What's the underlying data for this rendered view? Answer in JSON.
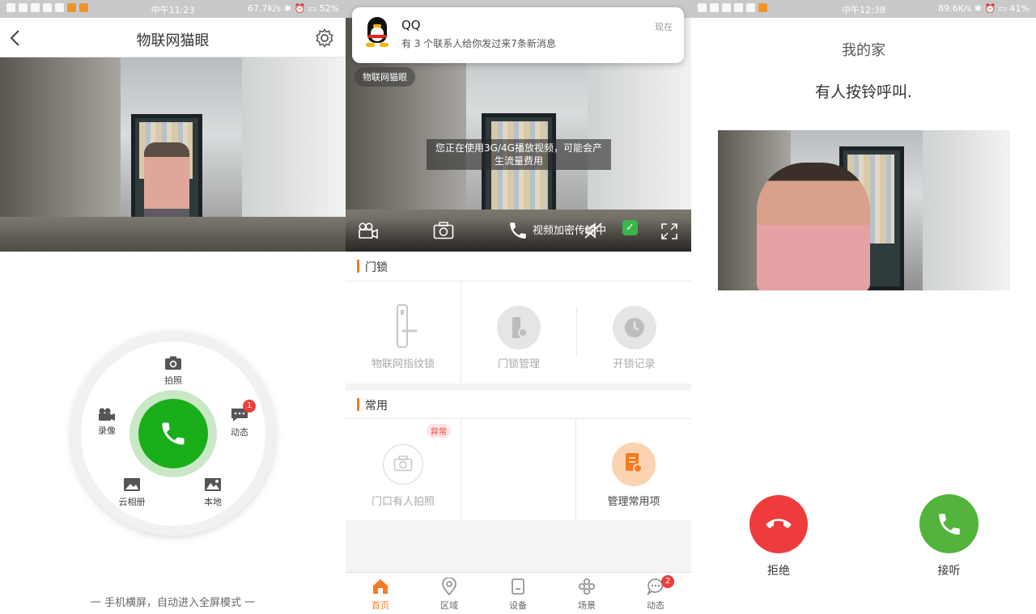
{
  "status": {
    "p1": {
      "time": "中午11:23",
      "speed": "67.7K/s",
      "battery": "52%"
    },
    "p3": {
      "time": "中午12:38",
      "speed": "89.6K/s",
      "battery": "41%"
    }
  },
  "screen1": {
    "title": "物联网猫眼",
    "wheel": {
      "photo": "拍照",
      "record": "录像",
      "moments": "动态",
      "moments_badge": "1",
      "cloud_album": "云相册",
      "local": "本地"
    },
    "hint": "一 手机横屏，自动进入全屏模式 一"
  },
  "screen2": {
    "notification": {
      "app": "QQ",
      "time": "现在",
      "message": "有 3 个联系人给你发过来7条新消息"
    },
    "cam_label": "物联网猫眼",
    "toast": "您正在使用3G/4G播放视频，可能会产生流量费用",
    "encrypt": "视频加密传输中",
    "lock_section": {
      "title": "门锁",
      "items": [
        "物联网指纹锁",
        "门锁管理",
        "开锁记录"
      ]
    },
    "common_section": {
      "title": "常用",
      "abnormal": "异常",
      "items": [
        "门口有人拍照",
        "管理常用项"
      ]
    },
    "tabs": [
      "首页",
      "区域",
      "设备",
      "场景",
      "动态"
    ],
    "tab_badge": "2"
  },
  "screen3": {
    "title": "我的家",
    "message": "有人按铃呼叫.",
    "decline": "拒绝",
    "accept": "接听"
  },
  "colors": {
    "green": "#1aae1a",
    "orange": "#f57c22",
    "red": "#ee3c3c",
    "accept": "#52b43c"
  }
}
